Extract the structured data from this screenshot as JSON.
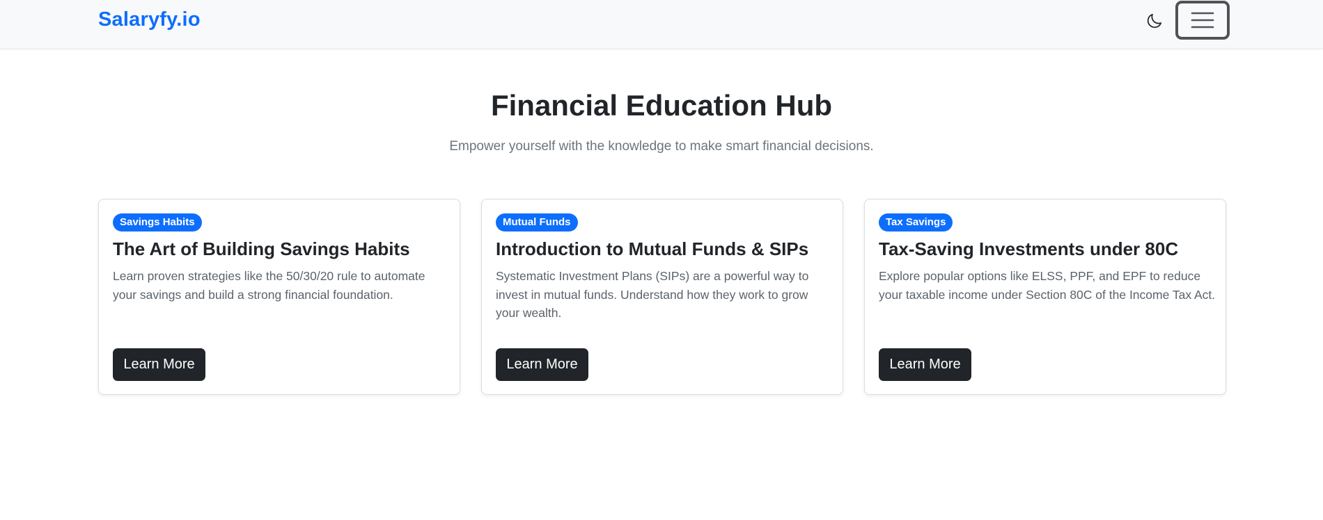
{
  "navbar": {
    "brand": "Salaryfy.io",
    "theme_icon": "moon-icon",
    "menu_icon": "hamburger-icon"
  },
  "hero": {
    "title": "Financial Education Hub",
    "subtitle": "Empower yourself with the knowledge to make smart financial decisions."
  },
  "cards": [
    {
      "badge": "Savings Habits",
      "title": "The Art of Building Savings Habits",
      "text": "Learn proven strategies like the 50/30/20 rule to automate your savings and build a strong financial foundation.",
      "button": "Learn More"
    },
    {
      "badge": "Mutual Funds",
      "title": "Introduction to Mutual Funds & SIPs",
      "text": "Systematic Investment Plans (SIPs) are a powerful way to invest in mutual funds. Understand how they work to grow your wealth.",
      "button": "Learn More"
    },
    {
      "badge": "Tax Savings",
      "title": "Tax-Saving Investments under 80C",
      "text": "Explore popular options like ELSS, PPF, and EPF to reduce your taxable income under Section 80C of the Income Tax Act.",
      "button": "Learn More"
    }
  ],
  "colors": {
    "brand": "#0d6efd",
    "badge_bg": "#0d6efd",
    "button_bg": "#212529",
    "navbar_bg": "#f8f9fa",
    "text_muted": "#6c757d"
  }
}
